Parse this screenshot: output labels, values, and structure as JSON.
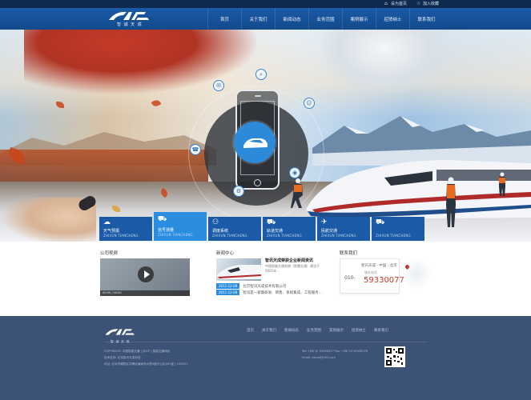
{
  "topbar": {
    "links": [
      {
        "icon": "home-icon",
        "label": "设为首页"
      },
      {
        "icon": "star-icon",
        "label": "加入收藏"
      }
    ]
  },
  "header": {
    "logo_mark": "ZHTC",
    "logo_text": "智 诚 天 成",
    "nav": [
      "首页",
      "关于我们",
      "新闻动态",
      "业务范围",
      "案例展示",
      "招贤纳士",
      "联系我们"
    ]
  },
  "service_tabs": [
    {
      "icon": "cloud-icon",
      "name": "天气预报",
      "sub": "ZHIXUN TIANCHENG",
      "active": false
    },
    {
      "icon": "car-icon",
      "name": "信号测量",
      "sub": "ZHIXUN TIANCHENG",
      "active": true
    },
    {
      "icon": "people-icon",
      "name": "调度系统",
      "sub": "ZHIXUN TIANCHENG",
      "active": false
    },
    {
      "icon": "truck-icon",
      "name": "轨道交通",
      "sub": "ZHIXUN TIANCHENG",
      "active": false
    },
    {
      "icon": "plane-icon",
      "name": "民航交通",
      "sub": "ZHIXUN TIANCHENG",
      "active": false
    },
    {
      "icon": "van-icon",
      "name": "",
      "sub": "ZHIXUN TIANCHENG",
      "active": false
    }
  ],
  "content": {
    "video_title": "公司视频",
    "video_controls": "00:00 / 00:00",
    "news_title": "新闻中心",
    "news_head": "智讯天成荣获企业新闻资讯",
    "news_desc": "中国智能交通系统（智慧交通）建设于2001年...",
    "news_items": [
      {
        "date": "2011-12-08",
        "text": "北京智讯天成技术有限公司"
      },
      {
        "date": "2011-12-08",
        "text": "智讯是一家集研发、销售、系统集成、工程服务..."
      }
    ],
    "contact_title": "联系我们",
    "contact_line": "智讯天成 · 中国 · 北京",
    "contact_label": "服务电话",
    "contact_area": "010-",
    "contact_number": "59330077"
  },
  "footer": {
    "logo_mark": "ZHTC",
    "logo_text": "智 诚 天 成",
    "nav": [
      "首页",
      "关于我们",
      "新闻动态",
      "业务范围",
      "案例展示",
      "招贤纳士",
      "联系我们"
    ],
    "copyright": [
      "COPYRIGHT: 中国智能交通 | 京ICP | 智能交通网站",
      "技术支持: 北京智讯天成科技",
      "地址: 北京市朝阳区华腾北塘商务大厦A座办公区301室 | 100021"
    ],
    "contact": [
      "Tel: +86 10 59330077      Fax: +86 10 59330076",
      "Email: zxtcw@163.com"
    ]
  },
  "colors": {
    "header": "#1a5aa6",
    "accent": "#2a8de0",
    "footer": "#3d5277",
    "phone_number": "#c13b2a"
  }
}
